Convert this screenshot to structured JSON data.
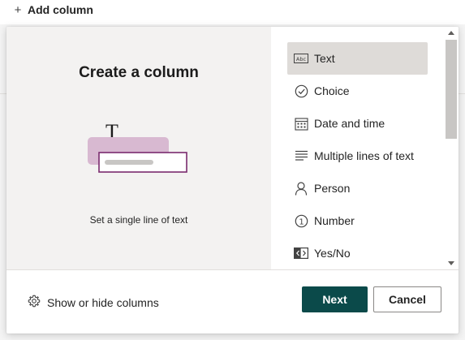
{
  "topbar": {
    "add_column_label": "Add column"
  },
  "preview": {
    "title": "Create a column",
    "description": "Set a single line of text",
    "illustration_glyph": "T"
  },
  "column_types": {
    "items": [
      {
        "label": "Text",
        "icon": "text-icon",
        "selected": true
      },
      {
        "label": "Choice",
        "icon": "choice-icon",
        "selected": false
      },
      {
        "label": "Date and time",
        "icon": "calendar-icon",
        "selected": false
      },
      {
        "label": "Multiple lines of text",
        "icon": "multiline-icon",
        "selected": false
      },
      {
        "label": "Person",
        "icon": "person-icon",
        "selected": false
      },
      {
        "label": "Number",
        "icon": "number-icon",
        "selected": false
      },
      {
        "label": "Yes/No",
        "icon": "yes-no-icon",
        "selected": false
      }
    ],
    "text_icon_glyph": "Abc",
    "number_icon_glyph": "1"
  },
  "footer": {
    "show_hide_label": "Show or hide columns",
    "next_label": "Next",
    "cancel_label": "Cancel"
  },
  "colors": {
    "primary_button": "#0b4a4a",
    "selected_item_bg": "#dedbd8",
    "preview_bg": "#f3f2f1",
    "illustration_fill": "#d8b9d1",
    "illustration_border": "#7a2b6e"
  }
}
